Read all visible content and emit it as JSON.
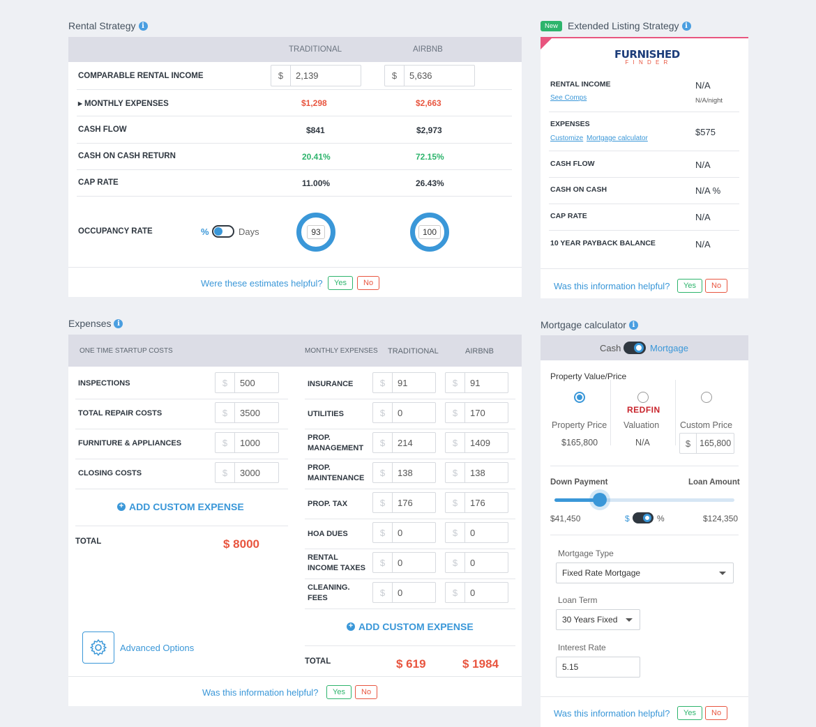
{
  "rental": {
    "title": "Rental Strategy",
    "col_traditional": "TRADITIONAL",
    "col_airbnb": "AIRBNB",
    "rows": {
      "income_label": "COMPARABLE RENTAL INCOME",
      "income_trad": "2,139",
      "income_air": "5,636",
      "expenses_label": "MONTHLY EXPENSES",
      "expenses_trad": "$1,298",
      "expenses_air": "$2,663",
      "cashflow_label": "CASH FLOW",
      "cashflow_trad": "$841",
      "cashflow_air": "$2,973",
      "coc_label": "CASH ON CASH RETURN",
      "coc_trad": "20.41%",
      "coc_air": "72.15%",
      "cap_label": "CAP RATE",
      "cap_trad": "11.00%",
      "cap_air": "26.43%",
      "occ_label": "OCCUPANCY RATE",
      "occ_pct": "%",
      "occ_days": "Days",
      "occ_trad": "93",
      "occ_air": "100"
    },
    "helpful": "Were these estimates helpful?",
    "yes": "Yes",
    "no": "No"
  },
  "extended": {
    "badge": "New",
    "title": "Extended Listing Strategy",
    "logo_top": "FURNISHED",
    "logo_bottom": "F I N D E R",
    "rental_income_label": "RENTAL INCOME",
    "see_comps": "See Comps",
    "rental_income_value": "N/A",
    "rental_income_sub": "N/A/night",
    "expenses_label": "EXPENSES",
    "customize": "Customize",
    "mortgage_calc": "Mortgage calculator",
    "expenses_value": "$575",
    "cashflow_label": "CASH FLOW",
    "cashflow_value": "N/A",
    "coc_label": "CASH ON CASH",
    "coc_value": "N/A %",
    "cap_label": "CAP RATE",
    "cap_value": "N/A",
    "payback_label": "10 YEAR PAYBACK BALANCE",
    "payback_value": "N/A",
    "helpful": "Was this information helpful?",
    "yes": "Yes",
    "no": "No"
  },
  "expenses": {
    "title": "Expenses",
    "one_time_header": "ONE TIME STARTUP COSTS",
    "monthly_header": "MONTHLY EXPENSES",
    "col_trad": "TRADITIONAL",
    "col_air": "AIRBNB",
    "one_time": [
      {
        "label": "INSPECTIONS",
        "value": "500"
      },
      {
        "label": "TOTAL REPAIR COSTS",
        "value": "3500"
      },
      {
        "label": "FURNITURE & APPLIANCES",
        "value": "1000"
      },
      {
        "label": "CLOSING COSTS",
        "value": "3000"
      }
    ],
    "monthly": [
      {
        "label1": "INSURANCE",
        "label2": "",
        "trad": "91",
        "air": "91"
      },
      {
        "label1": "UTILITIES",
        "label2": "",
        "trad": "0",
        "air": "170"
      },
      {
        "label1": "PROP.",
        "label2": "MANAGEMENT",
        "trad": "214",
        "air": "1409"
      },
      {
        "label1": "PROP.",
        "label2": "MAINTENANCE",
        "trad": "138",
        "air": "138"
      },
      {
        "label1": "PROP. TAX",
        "label2": "",
        "trad": "176",
        "air": "176"
      },
      {
        "label1": "HOA DUES",
        "label2": "",
        "trad": "0",
        "air": "0"
      },
      {
        "label1": "RENTAL",
        "label2": "INCOME TAXES",
        "trad": "0",
        "air": "0"
      },
      {
        "label1": "CLEANING.",
        "label2": "FEES",
        "trad": "0",
        "air": "0"
      }
    ],
    "add_custom": "ADD CUSTOM EXPENSE",
    "total_label": "TOTAL",
    "one_time_total": "$ 8000",
    "monthly_total_trad": "$ 619",
    "monthly_total_air": "$ 1984",
    "advanced": "Advanced Options",
    "helpful": "Was this information helpful?",
    "yes": "Yes",
    "no": "No",
    "currency": "$"
  },
  "mortgage": {
    "title": "Mortgage calculator",
    "cash": "Cash",
    "mortgage": "Mortgage",
    "property_value_label": "Property Value/Price",
    "opt1_label": "Property Price",
    "opt1_value": "$165,800",
    "opt2_logo": "REDFIN",
    "opt2_label": "Valuation",
    "opt2_value": "N/A",
    "opt3_label": "Custom Price",
    "opt3_value": "165,800",
    "down_payment_label": "Down Payment",
    "loan_amount_label": "Loan Amount",
    "down_payment_value": "$41,450",
    "loan_amount_value": "$124,350",
    "down_payment_fraction": 0.25,
    "toggle_dollar": "$",
    "toggle_pct": "%",
    "mortgage_type_label": "Mortgage Type",
    "mortgage_type_value": "Fixed Rate Mortgage",
    "loan_term_label": "Loan Term",
    "loan_term_value": "30 Years Fixed",
    "interest_label": "Interest Rate",
    "interest_value": "5.15",
    "helpful": "Was this information helpful?",
    "yes": "Yes",
    "no": "No"
  },
  "colors": {
    "accent": "#3a97d8",
    "positive": "#2db46c",
    "negative": "#e8553f"
  }
}
